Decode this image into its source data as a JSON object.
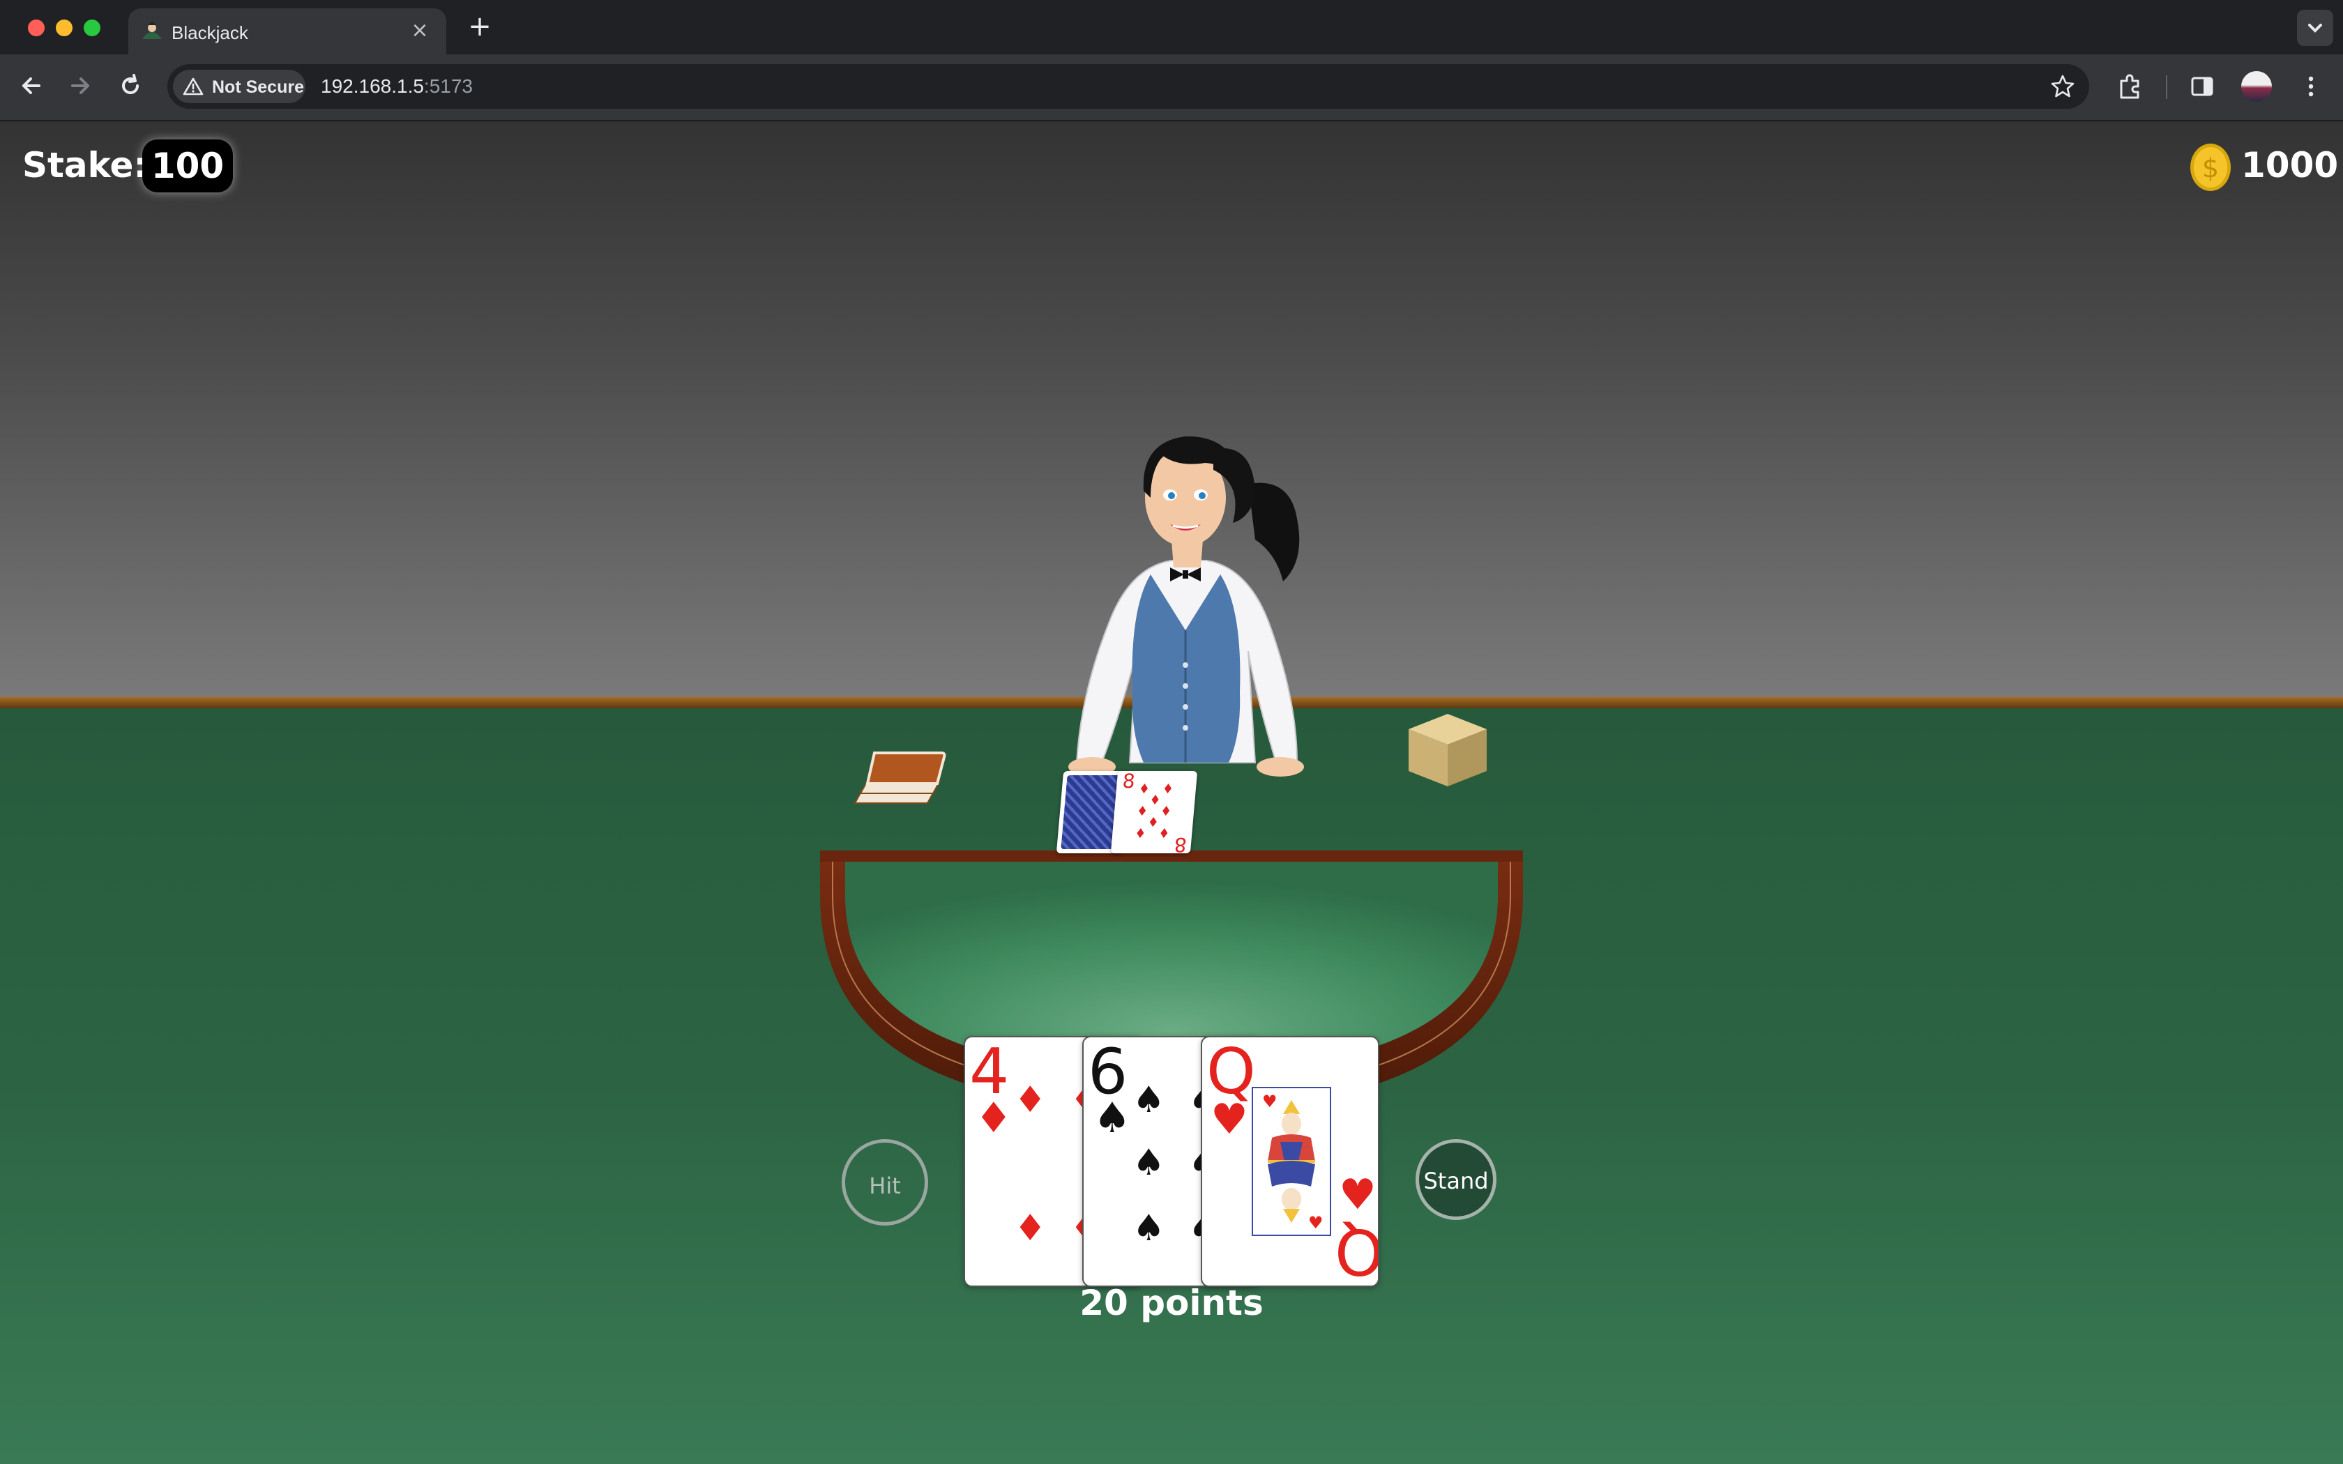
{
  "browser": {
    "tab_title": "Blackjack",
    "close_glyph": "×",
    "new_tab_glyph": "+",
    "security_label": "Not Secure",
    "url_host": "192.168.1.5",
    "url_port": ":5173"
  },
  "game": {
    "stake_label": "Stake:",
    "stake_value": "100",
    "balance": "1000",
    "dealer_hand": {
      "cards": [
        {
          "face": "down"
        },
        {
          "face": "up",
          "rank": "8",
          "suit": "diamonds"
        }
      ]
    },
    "player_hand": {
      "cards": [
        {
          "rank": "4",
          "suit": "diamonds",
          "suit_glyph": "♦"
        },
        {
          "rank": "6",
          "suit": "spades",
          "suit_glyph": "♠"
        },
        {
          "rank": "Q",
          "suit": "hearts",
          "suit_glyph": "♥"
        }
      ],
      "points_label": "20 points"
    },
    "buttons": {
      "hit": "Hit",
      "stand": "Stand"
    }
  },
  "colors": {
    "felt": "#2c6443",
    "card_red": "#e4231f",
    "wall_top": "#333333"
  }
}
